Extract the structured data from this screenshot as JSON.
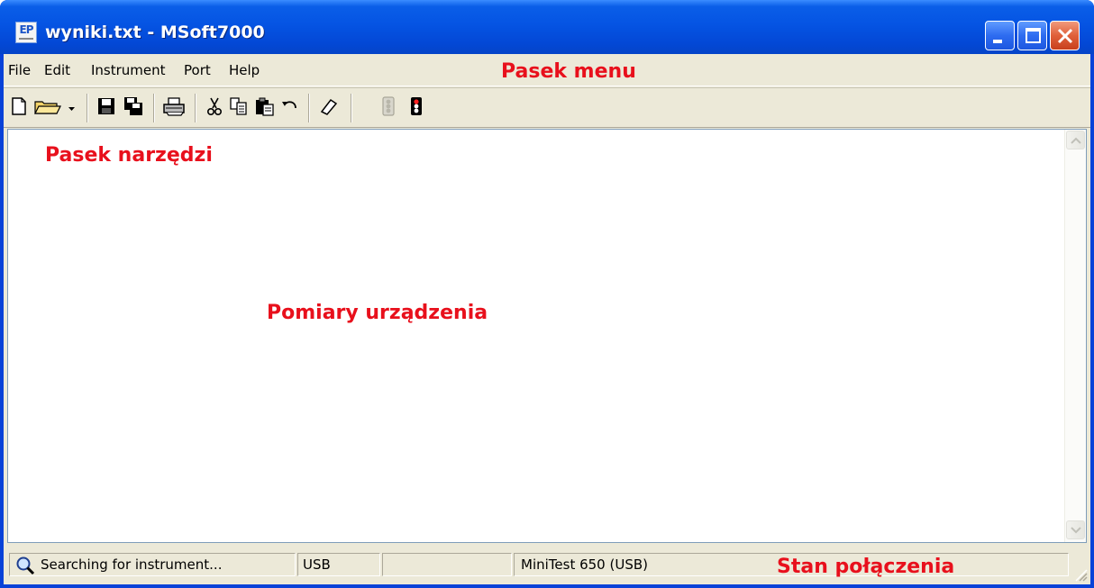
{
  "window": {
    "title": "wyniki.txt - MSoft7000",
    "app_icon_label": "EP"
  },
  "menu": {
    "items": [
      "File",
      "Edit",
      "Instrument",
      "Port",
      "Help"
    ]
  },
  "toolbar": {
    "icons": [
      "new-document-icon",
      "open-folder-icon",
      "dropdown-arrow-icon",
      "save-icon",
      "save-all-icon",
      "print-icon",
      "cut-icon",
      "copy-icon",
      "paste-icon",
      "undo-icon",
      "eraser-icon",
      "traffic-light-off-icon",
      "traffic-light-red-icon"
    ]
  },
  "editor": {
    "content": ""
  },
  "statusbar": {
    "status_text": "Searching for instrument...",
    "port": "USB",
    "empty_panel": "",
    "device": "MiniTest 650 (USB)"
  },
  "annotations": {
    "menu_label": "Pasek menu",
    "toolbar_label": "Pasek narzędzi",
    "measurements_label": "Pomiary urządzenia",
    "status_label": "Stan połączenia"
  },
  "colors": {
    "titlebar": "#0554e3",
    "annotation": "#e8101c",
    "chrome": "#ece9d8"
  }
}
